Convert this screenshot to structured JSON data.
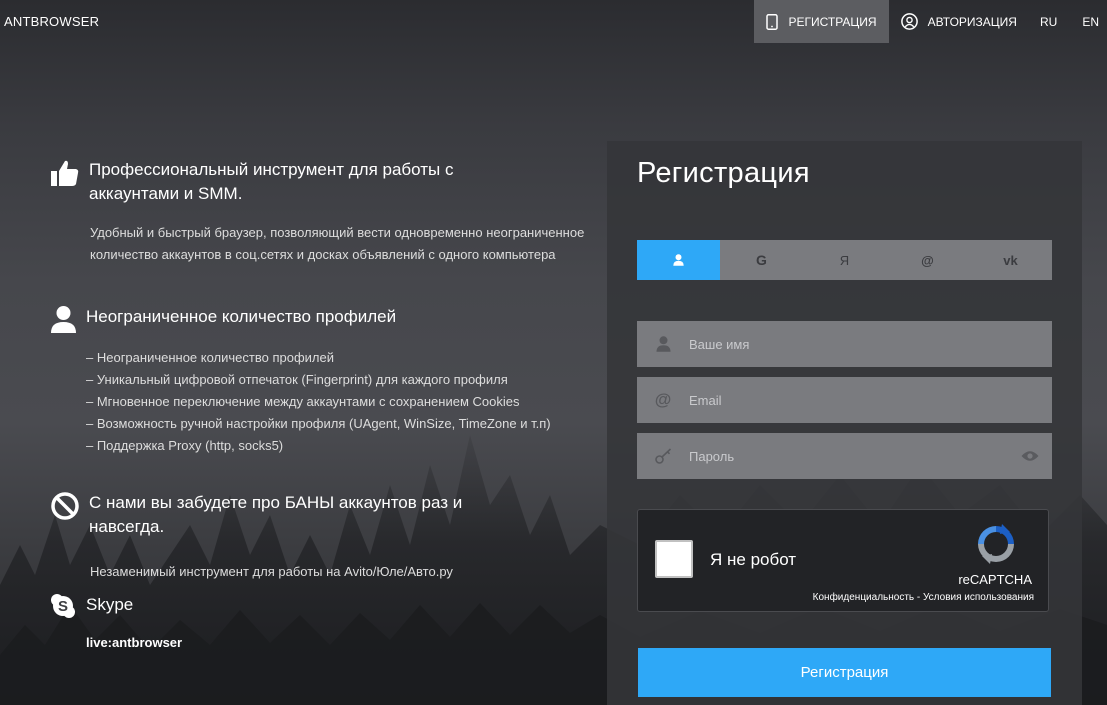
{
  "header": {
    "logo": "ANTBROWSER",
    "nav": {
      "register": "РЕГИСТРАЦИЯ",
      "login": "АВТОРИЗАЦИЯ",
      "lang_ru": "RU",
      "lang_en": "EN"
    }
  },
  "features": {
    "f1": {
      "icon": "thumbs-up-icon",
      "title": "Профессиональный инструмент для работы с аккаунтами и SMM.",
      "desc": "Удобный и быстрый браузер, позволяющий вести одновременно неограниченное количество аккаунтов в соц.сетях и досках объявлений с одного компьютера"
    },
    "f2": {
      "icon": "user-icon",
      "title": "Неограниченное количество профилей",
      "items": [
        "– Неограниченное количество профилей",
        "– Уникальный цифровой отпечаток (Fingerprint) для каждого профиля",
        "– Мгновенное переключение между аккаунтами с сохранением Cookies",
        "– Возможность ручной настройки профиля (UAgent, WinSize, TimeZone и т.п)",
        "– Поддержка Proxy (http, socks5)"
      ]
    },
    "f3": {
      "icon": "ban-icon",
      "title": "С нами вы забудете про БАНЫ аккаунтов раз и навсегда.",
      "desc": "Незаменимый инструмент для работы на Avito/Юле/Авто.ру"
    },
    "f4": {
      "icon": "skype-icon",
      "title": "Skype",
      "handle": "live:antbrowser"
    }
  },
  "registration": {
    "title": "Регистрация",
    "tabs": {
      "user": "user-icon",
      "google": "G",
      "yandex": "Я",
      "mail": "@",
      "vk": "vk"
    },
    "name_placeholder": "Ваше имя",
    "email_placeholder": "Email",
    "password_placeholder": "Пароль",
    "captcha": {
      "label": "Я не робот",
      "brand": "reCAPTCHA",
      "privacy": "Конфиденциальность",
      "separator": " - ",
      "terms": "Условия использования"
    },
    "submit": "Регистрация",
    "colors": {
      "accent": "#2ea8f7",
      "field": "#7a7b7f",
      "panel": "#343539"
    }
  }
}
